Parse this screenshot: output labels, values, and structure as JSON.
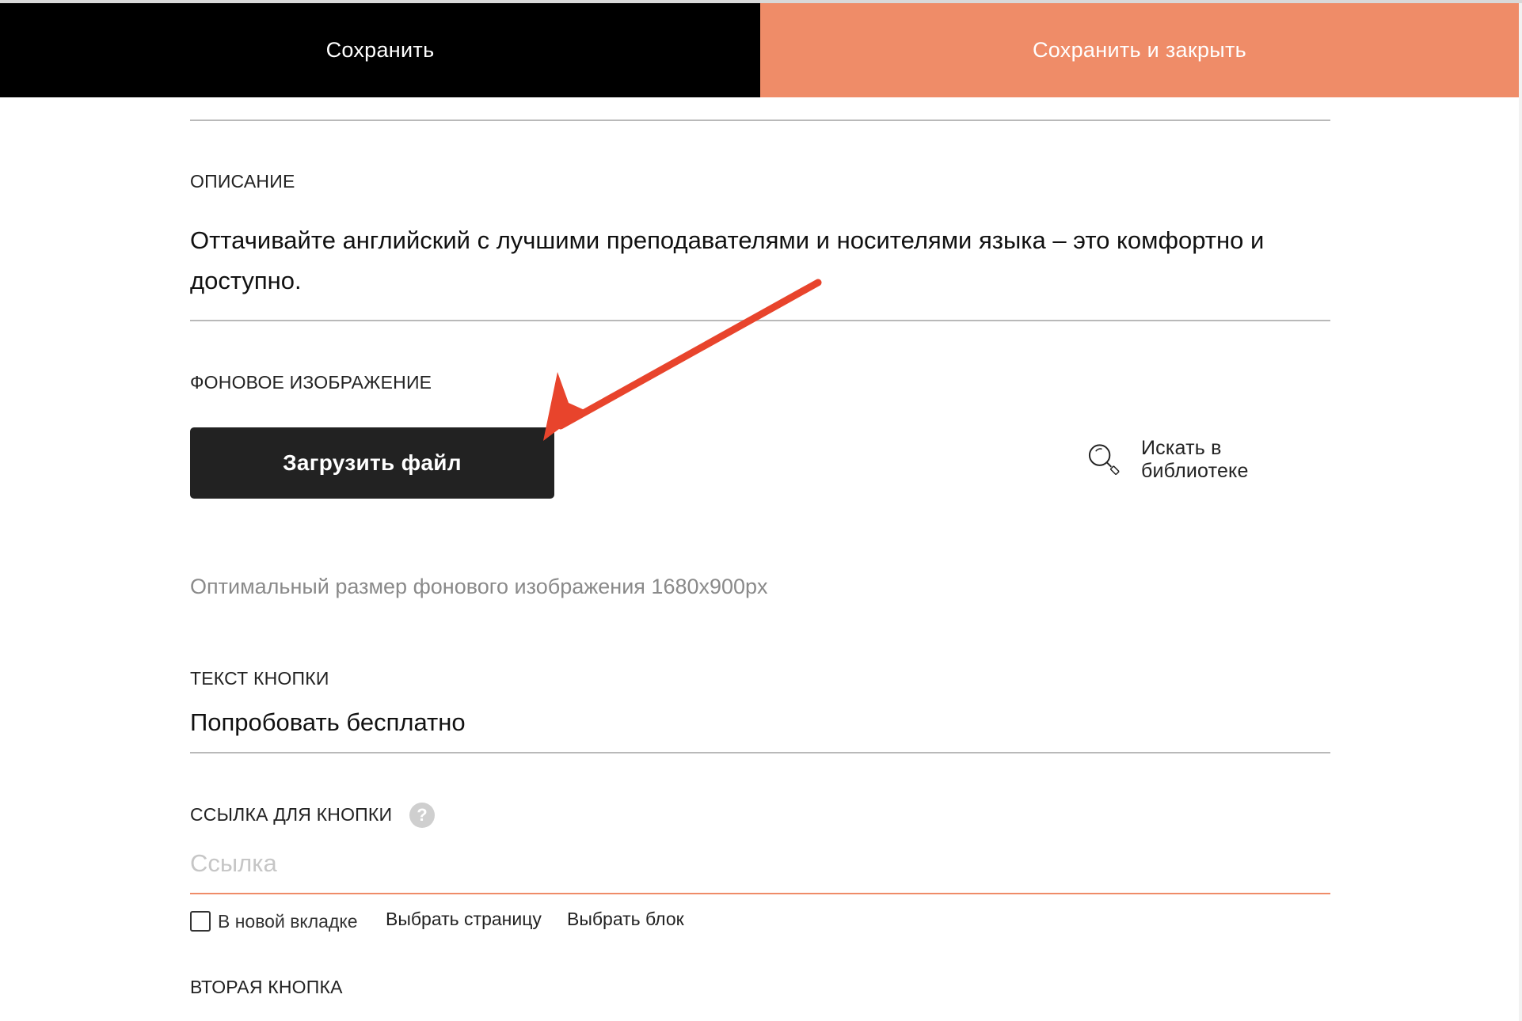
{
  "toolbar": {
    "save_label": "Сохранить",
    "save_close_label": "Сохранить и закрыть"
  },
  "description": {
    "label": "ОПИСАНИЕ",
    "text": "Оттачивайте английский с лучшими преподавателями и носителями языка – это комфортно и доступно."
  },
  "background_image": {
    "label": "ФОНОВОЕ ИЗОБРАЖЕНИЕ",
    "upload_label": "Загрузить файл",
    "library_label": "Искать в библиотеке",
    "library_icon": "search-icon",
    "hint": "Оптимальный размер фонового изображения 1680x900px"
  },
  "button_text": {
    "label": "ТЕКСТ КНОПКИ",
    "value": "Попробовать бесплатно"
  },
  "button_link": {
    "label": "ССЫЛКА ДЛЯ КНОПКИ",
    "help_icon": "question-icon",
    "help_glyph": "?",
    "placeholder": "Ссылка",
    "value": "",
    "new_tab_label": "В новой вкладке",
    "new_tab_checked": false,
    "choose_page_label": "Выбрать страницу",
    "choose_block_label": "Выбрать блок"
  },
  "second_button": {
    "label": "ВТОРАЯ КНОПКА"
  },
  "annotation": {
    "arrow_icon": "red-arrow-icon",
    "target": "upload-file-button"
  },
  "colors": {
    "save_bg": "#000000",
    "save_close_bg": "#ef8c68",
    "upload_bg": "#222222",
    "accent_underline": "#ef8c68",
    "arrow": "#e8442c",
    "muted_text": "#8a8a8a",
    "placeholder_text": "#c6c6c6"
  }
}
